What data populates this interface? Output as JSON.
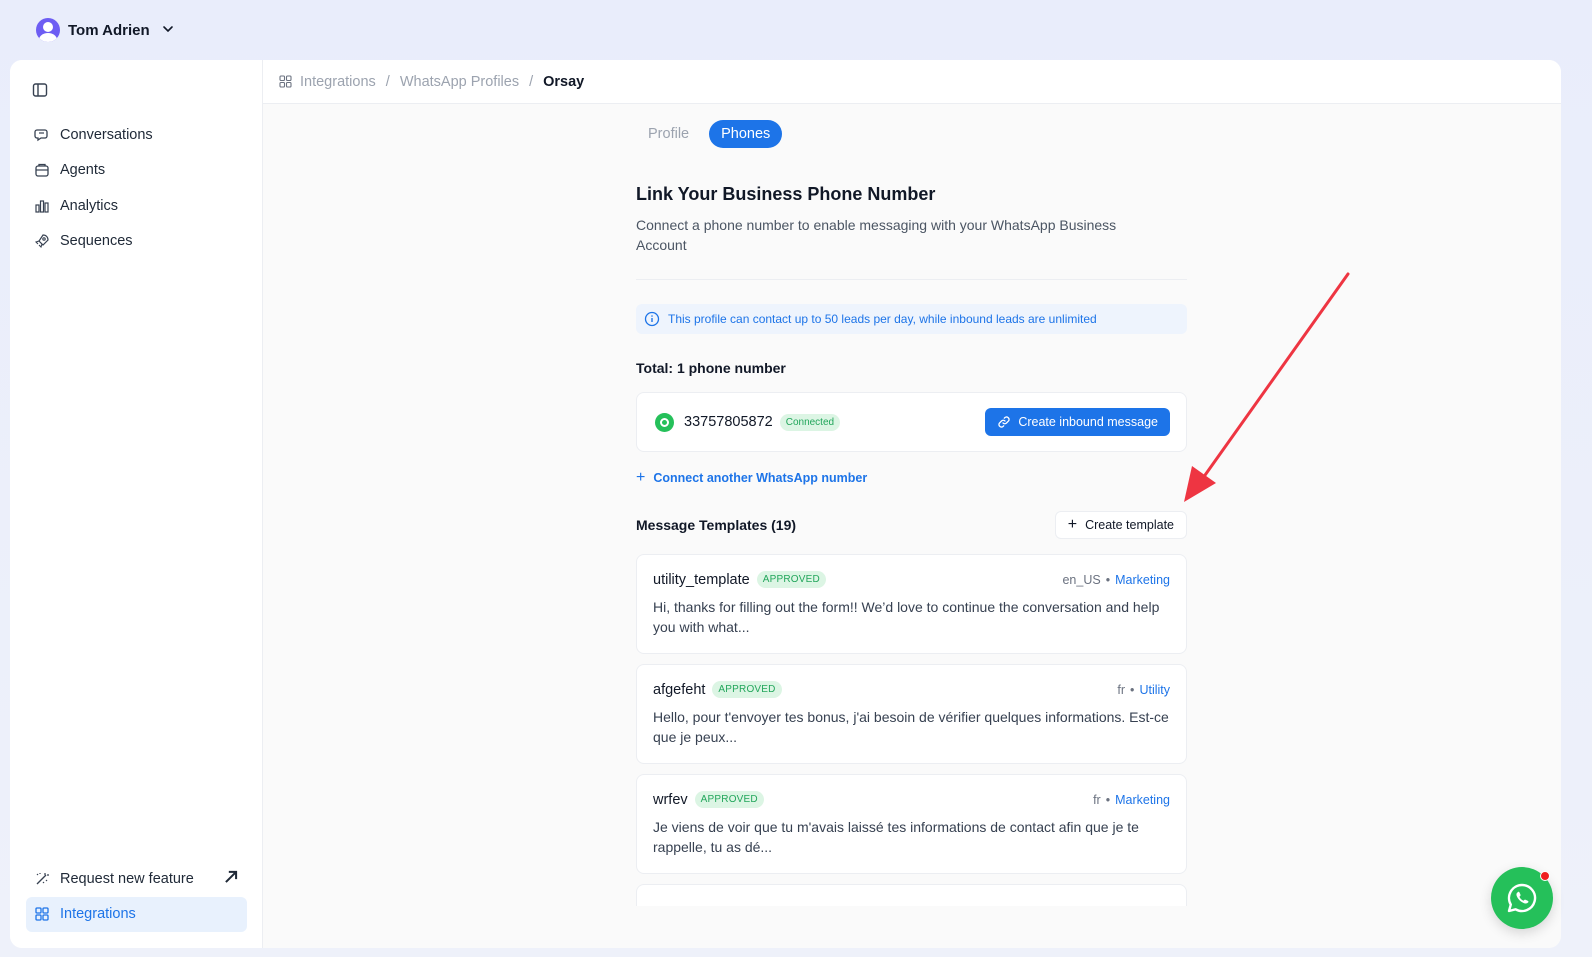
{
  "user": {
    "name": "Tom Adrien"
  },
  "sidebar": {
    "items": [
      {
        "label": "Conversations",
        "icon": "chat-icon"
      },
      {
        "label": "Agents",
        "icon": "agent-icon"
      },
      {
        "label": "Analytics",
        "icon": "bar-chart-icon"
      },
      {
        "label": "Sequences",
        "icon": "rocket-icon"
      }
    ],
    "bottom": [
      {
        "label": "Request new feature",
        "icon": "wand-icon"
      },
      {
        "label": "Integrations",
        "icon": "grid-icon",
        "active": true
      }
    ]
  },
  "breadcrumb": {
    "items": [
      "Integrations",
      "WhatsApp Profiles",
      "Orsay"
    ],
    "separator": "/"
  },
  "tabs": [
    "Profile",
    "Phones"
  ],
  "active_tab": "Phones",
  "section": {
    "title": "Link Your Business Phone Number",
    "description": "Connect a phone number to enable messaging with your WhatsApp Business Account"
  },
  "info_banner": "This profile can contact up to 50 leads per day, while inbound leads are unlimited",
  "total_label": "Total: 1 phone number",
  "phone": {
    "number": "33757805872",
    "status": "Connected",
    "action_label": "Create inbound message"
  },
  "connect_another_label": "Connect another WhatsApp number",
  "templates": {
    "title": "Message Templates (19)",
    "create_label": "Create template",
    "items": [
      {
        "name": "utility_template",
        "status": "APPROVED",
        "lang": "en_US",
        "category": "Marketing",
        "body": "Hi, thanks for filling out the form!! We’d love to continue the conversation and help you with what..."
      },
      {
        "name": "afgefeht",
        "status": "APPROVED",
        "lang": "fr",
        "category": "Utility",
        "body": "Hello, pour t'envoyer tes bonus, j'ai besoin de vérifier quelques informations. Est-ce que je peux..."
      },
      {
        "name": "wrfev",
        "status": "APPROVED",
        "lang": "fr",
        "category": "Marketing",
        "body": "Je viens de voir que tu m'avais laissé tes informations de contact afin que je te rappelle, tu as dé..."
      }
    ]
  },
  "colors": {
    "accent": "#1d74e8",
    "whatsapp": "#25c05a",
    "approved_bg": "#dcf5e4",
    "annotation_arrow": "#ee3542"
  }
}
